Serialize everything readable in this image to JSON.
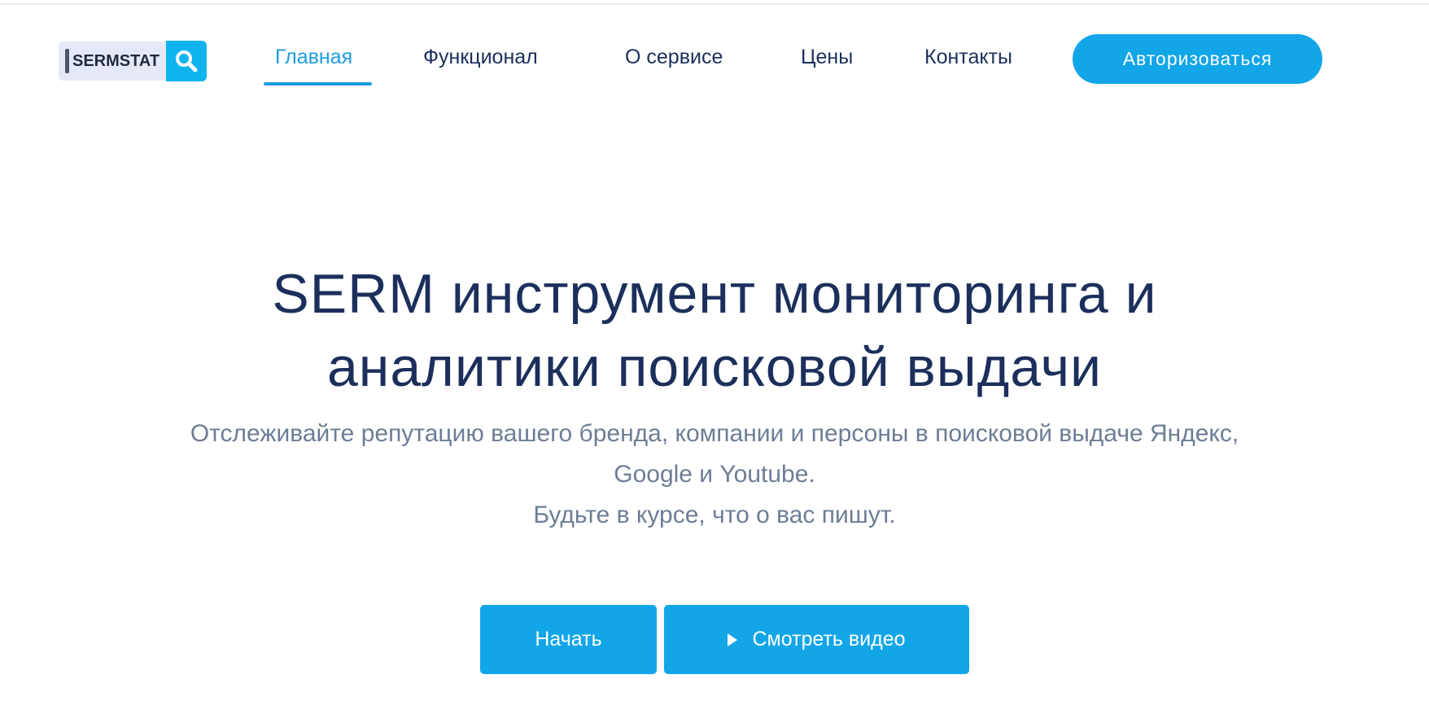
{
  "brand": {
    "logo_text": "SERMSTAT",
    "logo_icon": "magnifier-icon",
    "accent_color": "#12a6e9"
  },
  "nav": {
    "items": [
      {
        "label": "Главная",
        "active": true
      },
      {
        "label": "Функционал",
        "active": false
      },
      {
        "label": "О сервисе",
        "active": false
      },
      {
        "label": "Цены",
        "active": false
      },
      {
        "label": "Контакты",
        "active": false
      }
    ],
    "auth_label": "Авторизоваться"
  },
  "hero": {
    "title_line1": "SERM инструмент мониторинга и",
    "title_line2": "аналитики поисковой выдачи",
    "subtitle_line1": "Отслеживайте репутацию вашего бренда, компании и персоны в поисковой выдаче Яндекс,",
    "subtitle_line2": "Google и Youtube.",
    "subtitle_line3": "Будьте в курсе, что о вас пишут.",
    "start_label": "Начать",
    "video_label": "Смотреть видео",
    "video_icon": "play-icon"
  }
}
